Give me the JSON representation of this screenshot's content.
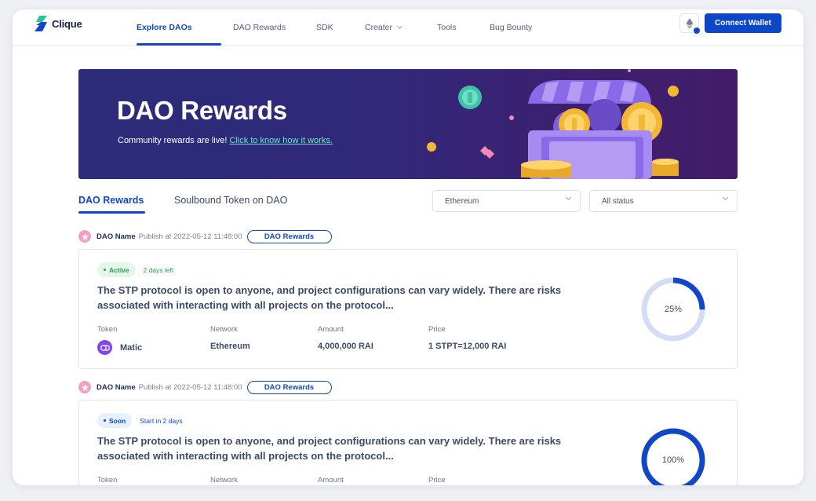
{
  "app": {
    "logo_text": "Clique"
  },
  "nav": {
    "links": [
      {
        "label": "Explore DAOs",
        "active": true
      },
      {
        "label": "DAO Rewards"
      },
      {
        "label": "SDK"
      },
      {
        "label": "Creater",
        "has_dropdown": true
      },
      {
        "label": "Tools"
      },
      {
        "label": "Bug Bounty"
      }
    ],
    "connect_label": "Connect Wallet",
    "network_icon": "ethereum-icon"
  },
  "banner": {
    "title": "DAO Rewards",
    "subtitle": "Community rewards are live! ",
    "link": "Click to know how it works."
  },
  "tabs": [
    {
      "label": "DAO Rewards",
      "active": true
    },
    {
      "label": "Soulbound Token on DAO"
    }
  ],
  "filters": {
    "network": "Ethereum",
    "status": "All status"
  },
  "rewards": [
    {
      "dao_name": "DAO Name",
      "publish": "Publish at 2022-05-12 11:48:00",
      "tag": "DAO Rewards",
      "status": "Active",
      "hint": "2 days left",
      "description": "The STP protocol is open to anyone, and project configurations can vary widely. There are risks associated with interacting with all projects on the protocol...",
      "labels": {
        "token": "Token",
        "network": "Network",
        "amount": "Amount",
        "price": "Price"
      },
      "token": "Matic",
      "network": "Ethereum",
      "amount": "4,000,000 RAI",
      "price": "1 STPT=12,000 RAI",
      "progress_label": "25%",
      "progress": 0.25
    },
    {
      "dao_name": "DAO Name",
      "publish": "Publish at 2022-05-12 11:48:00",
      "tag": "DAO Rewards",
      "status": "Soon",
      "hint": "Start in 2 days",
      "description": "The STP protocol is open to anyone, and project configurations can vary widely. There are risks associated with interacting with all projects on the protocol...",
      "labels": {
        "token": "Token",
        "network": "Network",
        "amount": "Amount",
        "price": "Price"
      },
      "progress_label": "100%",
      "progress": 1.0
    }
  ],
  "colors": {
    "primary": "#1047c8",
    "active_green": "#25a04a",
    "banner_bg": "#2c2c7a",
    "ring_track": "#d3ddf5",
    "matic_purple": "#8247e5"
  }
}
